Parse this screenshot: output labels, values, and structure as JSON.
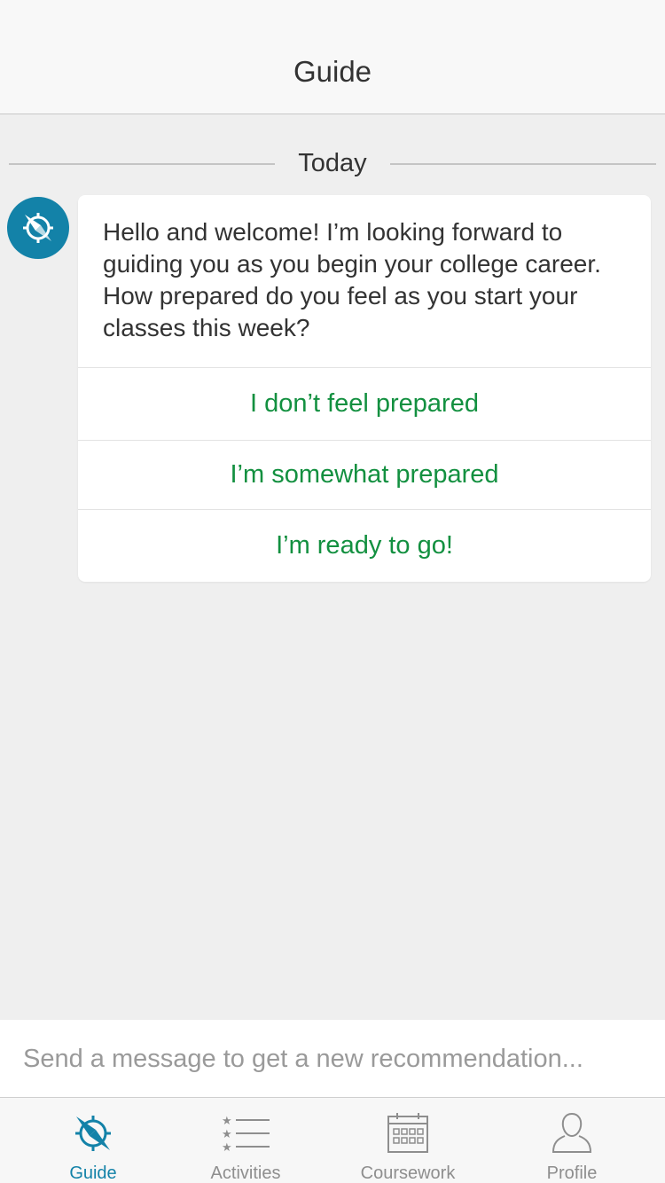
{
  "header": {
    "title": "Guide"
  },
  "divider": {
    "label": "Today"
  },
  "message": {
    "avatar_icon": "compass-icon",
    "text": "Hello and welcome! I’m looking forward to guiding you as you begin your college career. How prepared do you feel as you start your classes this week?",
    "choices": [
      {
        "label": "I don’t feel prepared"
      },
      {
        "label": "I’m somewhat prepared"
      },
      {
        "label": "I’m ready to go!"
      }
    ]
  },
  "composer": {
    "placeholder": "Send a message to get a new recommendation...",
    "value": ""
  },
  "tabs": [
    {
      "label": "Guide",
      "icon": "compass-icon",
      "active": true
    },
    {
      "label": "Activities",
      "icon": "starred-list-icon",
      "active": false
    },
    {
      "label": "Coursework",
      "icon": "calendar-icon",
      "active": false
    },
    {
      "label": "Profile",
      "icon": "person-icon",
      "active": false
    }
  ],
  "colors": {
    "accent": "#1382a8",
    "choice_text": "#139040",
    "background": "#efefef"
  }
}
